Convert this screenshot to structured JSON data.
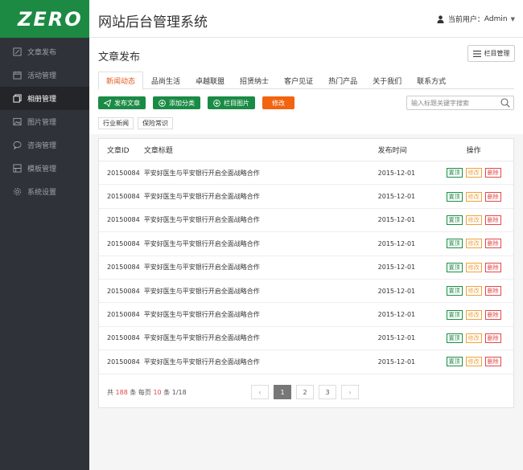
{
  "logo": "ZERO",
  "sidebar": {
    "items": [
      {
        "label": "文章发布",
        "icon": "pencil-icon",
        "active": false
      },
      {
        "label": "活动管理",
        "icon": "calendar-icon",
        "active": false
      },
      {
        "label": "相册管理",
        "icon": "album-icon",
        "active": true
      },
      {
        "label": "图片管理",
        "icon": "image-icon",
        "active": false
      },
      {
        "label": "咨询管理",
        "icon": "chat-icon",
        "active": false
      },
      {
        "label": "模板管理",
        "icon": "template-icon",
        "active": false
      },
      {
        "label": "系统设置",
        "icon": "gear-icon",
        "active": false
      }
    ]
  },
  "header": {
    "title": "网站后台管理系统",
    "user_label": "当前用户：",
    "user_name": "Admin"
  },
  "panel": {
    "title": "文章发布",
    "column_button": "栏目管理"
  },
  "tabs": [
    "新闻动态",
    "品尚生活",
    "卓越联盟",
    "招贤纳士",
    "客户见证",
    "热门产品",
    "关于我们",
    "联系方式"
  ],
  "actions": {
    "publish": "发布文章",
    "add_category": "添加分类",
    "column_image": "栏目图片",
    "edit": "修改"
  },
  "search": {
    "placeholder": "输入标题关键字搜索"
  },
  "subcategories": [
    "行业新闻",
    "保险常识"
  ],
  "table": {
    "headers": {
      "id": "文章ID",
      "title": "文章标题",
      "time": "发布时间",
      "ops": "操作"
    },
    "rows": [
      {
        "id": "20150084",
        "title": "平安好医生与平安银行开启全面战略合作",
        "time": "2015-12-01"
      },
      {
        "id": "20150084",
        "title": "平安好医生与平安银行开启全面战略合作",
        "time": "2015-12-01"
      },
      {
        "id": "20150084",
        "title": "平安好医生与平安银行开启全面战略合作",
        "time": "2015-12-01"
      },
      {
        "id": "20150084",
        "title": "平安好医生与平安银行开启全面战略合作",
        "time": "2015-12-01"
      },
      {
        "id": "20150084",
        "title": "平安好医生与平安银行开启全面战略合作",
        "time": "2015-12-01"
      },
      {
        "id": "20150084",
        "title": "平安好医生与平安银行开启全面战略合作",
        "time": "2015-12-01"
      },
      {
        "id": "20150084",
        "title": "平安好医生与平安银行开启全面战略合作",
        "time": "2015-12-01"
      },
      {
        "id": "20150084",
        "title": "平安好医生与平安银行开启全面战略合作",
        "time": "2015-12-01"
      },
      {
        "id": "20150084",
        "title": "平安好医生与平安银行开启全面战略合作",
        "time": "2015-12-01"
      }
    ],
    "op_labels": {
      "top": "置顶",
      "edit": "修改",
      "delete": "删除"
    }
  },
  "pager": {
    "total_prefix": "共",
    "total": "188",
    "total_suffix": "条 每页",
    "per_page": "10",
    "per_page_suffix": "条 1/18",
    "pages": [
      "1",
      "2",
      "3"
    ],
    "current": "1"
  },
  "colors": {
    "brand_green": "#1c8a43",
    "sidebar_bg": "#2f3238",
    "accent_orange": "#f2640f",
    "tab_active": "#e2571c",
    "delete_red": "#e04848"
  }
}
